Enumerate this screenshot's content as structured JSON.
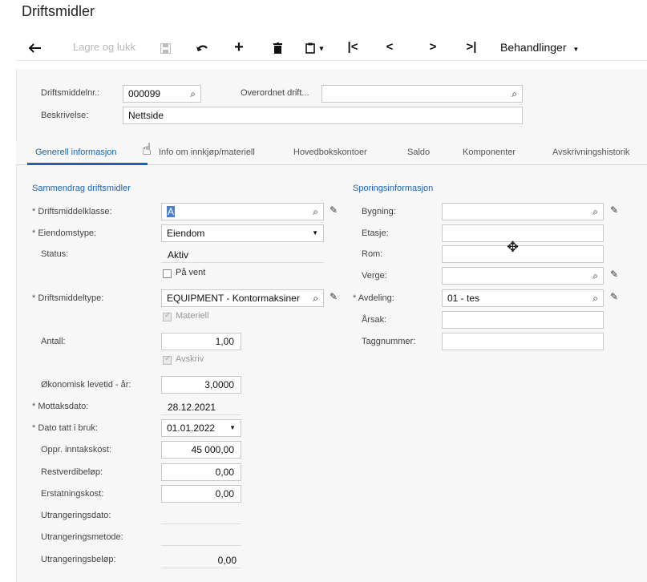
{
  "page": {
    "title": "Driftsmidler"
  },
  "toolbar": {
    "back_icon": "arrow-left-icon",
    "save_close_label": "Lagre og lukk",
    "save_icon": "floppy-disk-icon",
    "undo_icon": "undo-icon",
    "add_icon": "plus-icon",
    "delete_icon": "trash-icon",
    "clipboard_icon": "clipboard-icon",
    "first_icon": "first-page-icon",
    "prev_icon": "chevron-left-icon",
    "next_icon": "chevron-right-icon",
    "last_icon": "last-page-icon",
    "actions_label": "Behandlinger"
  },
  "header": {
    "asset_no_label": "Driftsmiddelnr.:",
    "asset_no_value": "000099",
    "parent_label": "Overordnet drift...",
    "parent_value": "",
    "description_label": "Beskrivelse:",
    "description_value": "Nettside"
  },
  "tabs": [
    {
      "label": "Generell informasjon",
      "active": true
    },
    {
      "label": "Info om innkjøp/materiell",
      "active": false
    },
    {
      "label": "Hovedbokskontoer",
      "active": false
    },
    {
      "label": "Saldo",
      "active": false
    },
    {
      "label": "Komponenter",
      "active": false
    },
    {
      "label": "Avskrivningshistorik",
      "active": false
    }
  ],
  "summary": {
    "title": "Sammendrag driftsmidler",
    "class_label": "Driftsmiddelklasse:",
    "class_value": "A",
    "property_type_label": "Eiendomstype:",
    "property_type_value": "Eiendom",
    "status_label": "Status:",
    "status_value": "Aktiv",
    "on_hold_label": "På vent",
    "asset_type_label": "Driftsmiddeltype:",
    "asset_type_value": "EQUIPMENT - Kontormaksiner",
    "materiel_label": "Materiell",
    "quantity_label": "Antall:",
    "quantity_value": "1,00",
    "depreciate_label": "Avskriv",
    "useful_life_label": "Økonomisk levetid - år:",
    "useful_life_value": "3,0000",
    "receipt_date_label": "Mottaksdato:",
    "receipt_date_value": "28.12.2021",
    "in_service_label": "Dato tatt i bruk:",
    "in_service_value": "01.01.2022",
    "orig_cost_label": "Oppr. inntakskost:",
    "orig_cost_value": "45 000,00",
    "salvage_label": "Restverdibeløp:",
    "salvage_value": "0,00",
    "replacement_label": "Erstatningskost:",
    "replacement_value": "0,00",
    "disposal_date_label": "Utrangeringsdato:",
    "disposal_method_label": "Utrangeringsmetode:",
    "disposal_amount_label": "Utrangeringsbeløp:",
    "disposal_amount_value": "0,00"
  },
  "tracking": {
    "title": "Sporingsinformasjon",
    "building_label": "Bygning:",
    "floor_label": "Etasje:",
    "room_label": "Rom:",
    "custodian_label": "Verge:",
    "department_label": "Avdeling:",
    "department_value": "01 - tes",
    "reason_label": "Årsak:",
    "tag_label": "Taggnummer:"
  },
  "icons": {
    "search": "search-icon",
    "edit": "pencil-icon",
    "dropdown": "chevron-down-icon",
    "pointer": "hand-pointer-icon",
    "move": "move-cursor-icon"
  }
}
